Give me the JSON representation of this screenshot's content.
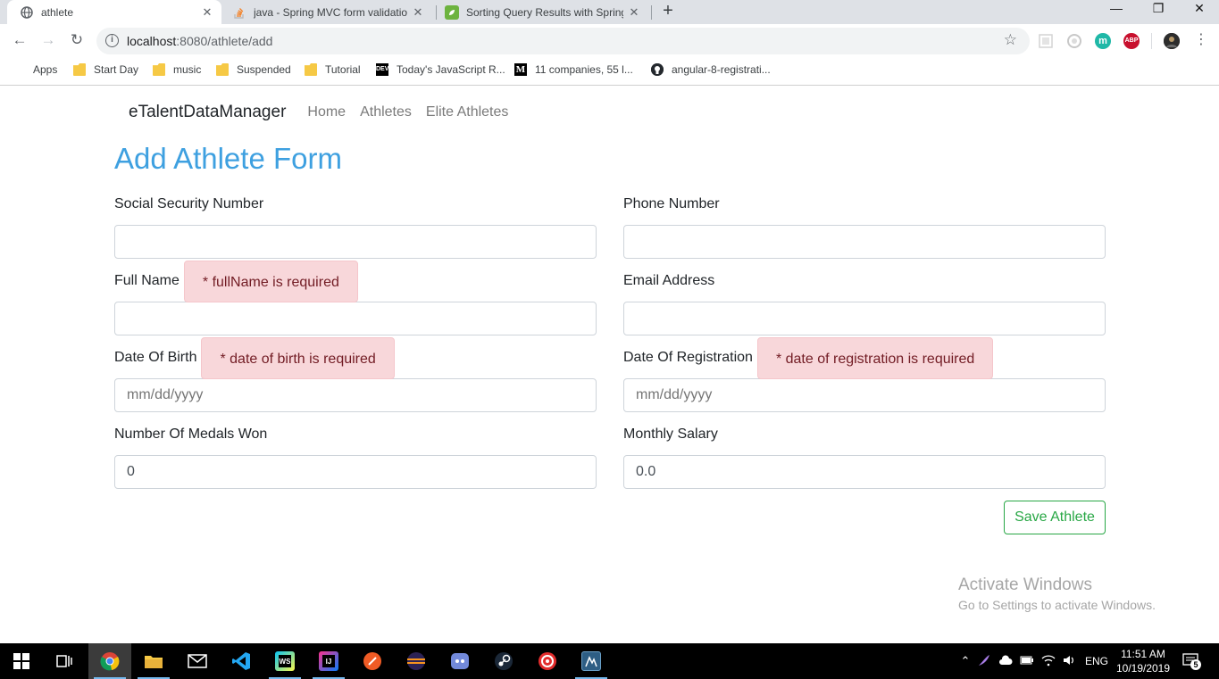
{
  "browser": {
    "tabs": [
      {
        "title": "athlete",
        "favicon": "globe-icon",
        "active": true
      },
      {
        "title": "java - Spring MVC form validation",
        "favicon": "stackoverflow-icon",
        "active": false
      },
      {
        "title": "Sorting Query Results with Spring",
        "favicon": "spring-leaf-icon",
        "active": false
      }
    ],
    "new_tab_label": "+",
    "address": {
      "host": "localhost",
      "rest": ":8080/athlete/add"
    },
    "bookmarks": [
      {
        "label": "Apps",
        "icon": "apps-grid-icon"
      },
      {
        "label": "Start Day",
        "icon": "folder-icon"
      },
      {
        "label": "music",
        "icon": "folder-icon"
      },
      {
        "label": "Suspended",
        "icon": "folder-icon"
      },
      {
        "label": "Tutorial",
        "icon": "folder-icon"
      },
      {
        "label": "Today's JavaScript R...",
        "icon": "dev-icon"
      },
      {
        "label": "11 companies, 55 l...",
        "icon": "medium-icon"
      },
      {
        "label": "angular-8-registrati...",
        "icon": "github-icon"
      }
    ],
    "extensions": [
      {
        "label": "",
        "color": "#d0d0d0"
      },
      {
        "label": "",
        "color": "#c8c8c8"
      },
      {
        "label": "m",
        "color": "#1fb8a7"
      },
      {
        "label": "ABP",
        "color": "#c8102e"
      },
      {
        "label": "",
        "color": "#333333"
      }
    ]
  },
  "app": {
    "brand": "eTalentDataManager",
    "nav": [
      "Home",
      "Athletes",
      "Elite Athletes"
    ],
    "form_title": "Add Athlete Form",
    "fields": {
      "ssn": {
        "label": "Social Security Number",
        "value": "",
        "placeholder": ""
      },
      "phone": {
        "label": "Phone Number",
        "value": "",
        "placeholder": ""
      },
      "full_name": {
        "label": "Full Name",
        "value": "",
        "placeholder": "",
        "error": "* fullName is required"
      },
      "email": {
        "label": "Email Address",
        "value": "",
        "placeholder": ""
      },
      "dob": {
        "label": "Date Of Birth",
        "value": "",
        "placeholder": "mm/dd/yyyy",
        "error": "* date of birth is required"
      },
      "dor": {
        "label": "Date Of Registration",
        "value": "",
        "placeholder": "mm/dd/yyyy",
        "error": "* date of registration is required"
      },
      "medals": {
        "label": "Number Of Medals Won",
        "value": "0",
        "placeholder": ""
      },
      "salary": {
        "label": "Monthly Salary",
        "value": "0.0",
        "placeholder": ""
      }
    },
    "save_label": "Save Athlete",
    "accent_color": "#3ea0e0",
    "success_color": "#28a745",
    "error_bg": "#f8d7da"
  },
  "watermark": {
    "line1": "Activate Windows",
    "line2": "Go to Settings to activate Windows."
  },
  "taskbar": {
    "apps": [
      "windows-start-icon",
      "task-view-icon",
      "chrome-icon",
      "file-explorer-icon",
      "mail-icon",
      "vscode-icon",
      "webstorm-icon",
      "intellij-icon",
      "postman-icon",
      "eclipse-icon",
      "discord-icon",
      "steam-icon",
      "app-icon",
      "spring-tool-suite-icon"
    ],
    "lang": "ENG",
    "time": "11:51 AM",
    "date": "10/19/2019",
    "notifications": "5"
  }
}
